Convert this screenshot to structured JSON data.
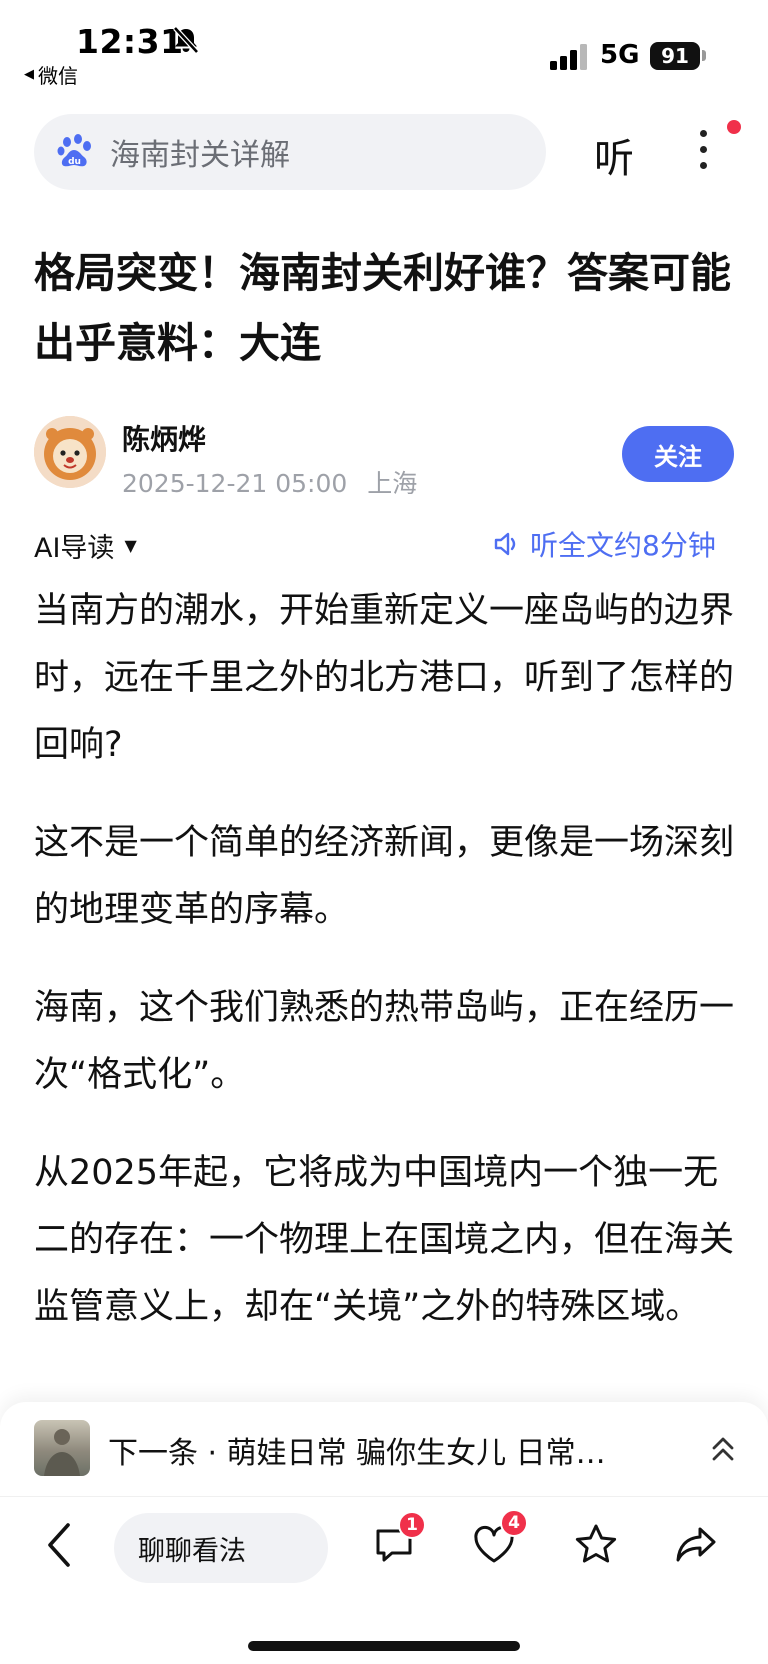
{
  "status_bar": {
    "time": "12:31",
    "back_app": "微信",
    "network": "5G",
    "battery": "91"
  },
  "search": {
    "query": "海南封关详解",
    "listen_label": "听"
  },
  "article": {
    "title": "格局突变！海南封关利好谁？答案可能出乎意料：大连",
    "author": "陈炳烨",
    "date": "2025-12-21 05:00",
    "location": "上海",
    "follow_label": "关注",
    "ai_guide_label": "AI导读",
    "listen_full_label": "听全文约8分钟",
    "paragraphs": [
      "当南方的潮水，开始重新定义一座岛屿的边界时，远在千里之外的北方港口，听到了怎样的回响?",
      "这不是一个简单的经济新闻，更像是一场深刻的地理变革的序幕。",
      "海南，这个我们熟悉的热带岛屿，正在经历一次“格式化”。",
      "从2025年起，它将成为中国境内一个独一无二的存在：一个物理上在国境之内，但在海关监管意义上，却在“关境”之外的特殊区域。"
    ]
  },
  "next_bar": {
    "text": "下一条 · 萌娃日常 骗你生女儿 日常…"
  },
  "toolbar": {
    "comment_placeholder": "聊聊看法",
    "comment_count": "1",
    "like_count": "4"
  },
  "colors": {
    "accent": "#4e6ef2",
    "badge": "#f0304a"
  }
}
